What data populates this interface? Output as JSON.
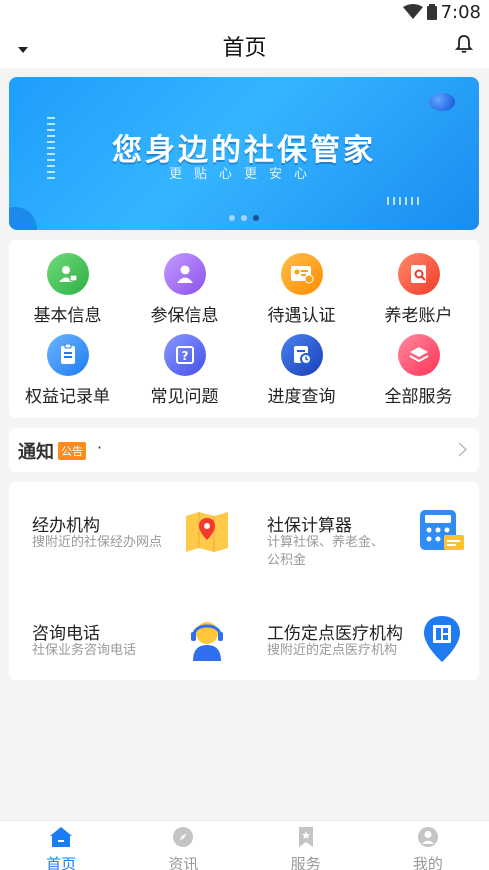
{
  "status_bar": {
    "time": "7:08"
  },
  "header": {
    "title": "首页"
  },
  "banner": {
    "main_text": "您身边的社保管家",
    "sub_text": "更贴心更安心",
    "slides": 3,
    "active_slide": 3
  },
  "quick_services": [
    {
      "label": "基本信息",
      "icon": "user-card-icon",
      "color": "#3fbf52"
    },
    {
      "label": "参保信息",
      "icon": "person-icon",
      "color": "#a06cf2"
    },
    {
      "label": "待遇认证",
      "icon": "id-card-check-icon",
      "color": "#ff9f1c"
    },
    {
      "label": "养老账户",
      "icon": "account-search-icon",
      "color": "#ff5a3c"
    },
    {
      "label": "权益记录单",
      "icon": "clipboard-icon",
      "color": "#2f8cf5"
    },
    {
      "label": "常见问题",
      "icon": "question-icon",
      "color": "#5b6cf5"
    },
    {
      "label": "进度查询",
      "icon": "progress-icon",
      "color": "#1d5fd6"
    },
    {
      "label": "全部服务",
      "icon": "layers-icon",
      "color": "#ff4f6e"
    }
  ],
  "notice": {
    "title": "通知",
    "tag": "公告",
    "text": "·"
  },
  "services": [
    {
      "name": "经办机构",
      "desc": "搜附近的社保经办网点",
      "icon": "map-pin-icon"
    },
    {
      "name": "社保计算器",
      "desc": "计算社保、养老金、公积金",
      "desc_lines": [
        "计算社保、养老金、",
        "公积金"
      ],
      "icon": "calculator-icon"
    },
    {
      "name": "咨询电话",
      "desc": "社保业务咨询电话",
      "icon": "headset-agent-icon"
    },
    {
      "name": "工伤定点医疗机构",
      "desc": "搜附近的定点医疗机构",
      "icon": "hospital-pin-icon"
    }
  ],
  "tabbar": [
    {
      "label": "首页",
      "icon": "home-icon",
      "active": true
    },
    {
      "label": "资讯",
      "icon": "compass-icon",
      "active": false
    },
    {
      "label": "服务",
      "icon": "bookmark-icon",
      "active": false
    },
    {
      "label": "我的",
      "icon": "profile-icon",
      "active": false
    }
  ],
  "colors": {
    "accent": "#1a7df5",
    "notice_tag": "#ff8c1a",
    "banner": "#1e9dfb"
  }
}
